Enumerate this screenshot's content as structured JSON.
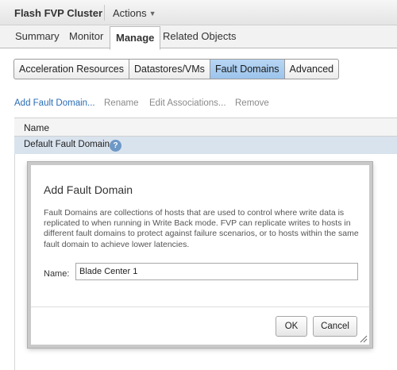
{
  "header": {
    "title": "Flash FVP Cluster",
    "actions_label": "Actions",
    "actions_caret": "▼"
  },
  "main_tabs": [
    {
      "label": "Summary",
      "active": false
    },
    {
      "label": "Monitor",
      "active": false
    },
    {
      "label": "Manage",
      "active": true
    },
    {
      "label": "Related Objects",
      "active": false
    }
  ],
  "sub_tabs": [
    {
      "label": "Acceleration Resources",
      "active": false
    },
    {
      "label": "Datastores/VMs",
      "active": false
    },
    {
      "label": "Fault Domains",
      "active": true
    },
    {
      "label": "Advanced",
      "active": false
    }
  ],
  "toolbar": [
    {
      "label": "Add Fault Domain...",
      "enabled": true
    },
    {
      "label": "Rename",
      "enabled": false
    },
    {
      "label": "Edit Associations...",
      "enabled": false
    },
    {
      "label": "Remove",
      "enabled": false
    }
  ],
  "grid": {
    "column_header": "Name",
    "rows": [
      {
        "name": "Default Fault Domain",
        "icon": "help-icon",
        "selected": true
      }
    ]
  },
  "dialog": {
    "title": "Add Fault Domain",
    "description": "Fault Domains are collections of hosts that are used to control where write data is replicated to when running in Write Back mode. FVP can replicate writes to hosts in different fault domains to protect against failure scenarios, or to hosts within the same fault domain to achieve lower latencies.",
    "name_label": "Name:",
    "name_value": "Blade Center 1",
    "ok_label": "OK",
    "cancel_label": "Cancel"
  },
  "help_glyph": "?",
  "colors": {
    "link": "#2a6db5",
    "selected_row": "#d9e3ee",
    "active_subtab": "#9cc4ec"
  }
}
